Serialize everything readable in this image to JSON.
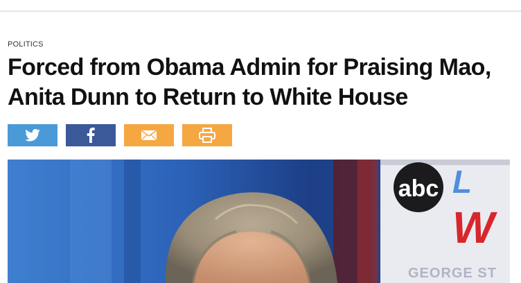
{
  "article": {
    "category": "POLITICS",
    "headline": "Forced from Obama Admin for Praising Mao, Anita Dunn to Return to White House"
  },
  "share": {
    "buttons": [
      {
        "icon": "twitter-bird-icon",
        "color": "#4a9ad8"
      },
      {
        "icon": "facebook-f-icon",
        "color": "#3b5998"
      },
      {
        "icon": "envelope-icon",
        "color": "#f5a742"
      },
      {
        "icon": "printer-icon",
        "color": "#f5a742"
      }
    ]
  },
  "hero": {
    "logo_text": "abc",
    "tv_text_red": "W",
    "tv_text_gray": "GEORGE ST"
  },
  "colors": {
    "twitter": "#4a9ad8",
    "facebook": "#3b5998",
    "email": "#f5a742",
    "print": "#f5a742",
    "headline": "#111111"
  }
}
